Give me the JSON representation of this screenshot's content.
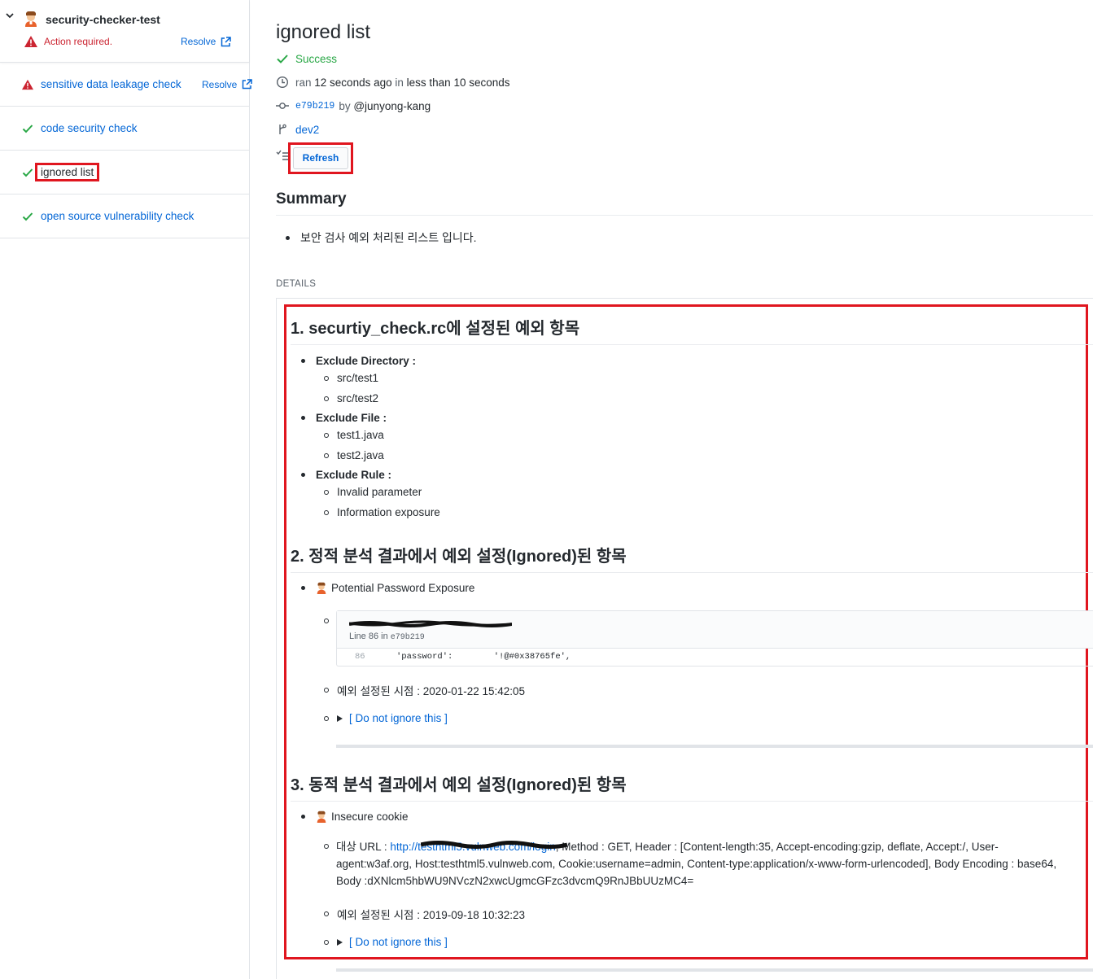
{
  "sidebar": {
    "app_name": "security-checker-test",
    "action_required": "Action required.",
    "resolve_label": "Resolve",
    "items": [
      {
        "label": "sensitive data leakage check",
        "status": "warning",
        "resolve": "Resolve"
      },
      {
        "label": "code security check",
        "status": "success"
      },
      {
        "label": "ignored list",
        "status": "success",
        "active": true
      },
      {
        "label": "open source vulnerability check",
        "status": "success"
      }
    ]
  },
  "run": {
    "title": "ignored list",
    "status": "Success",
    "ran_prefix": "ran",
    "ran_when": "12 seconds ago",
    "in_word": "in",
    "duration": "less than 10 seconds",
    "commit_sha": "e79b219",
    "by_word": "by",
    "author": "@junyong-kang",
    "branch": "dev2",
    "refresh_label": "Refresh"
  },
  "summary": {
    "heading": "Summary",
    "item": "보안 검사 예외 처리된 리스트 입니다."
  },
  "details": {
    "label": "DETAILS",
    "section1": {
      "heading": "1. securtiy_check.rc에 설정된 예외 항목",
      "groups": [
        {
          "title": "Exclude Directory :",
          "items": [
            "src/test1",
            "src/test2"
          ]
        },
        {
          "title": "Exclude File :",
          "items": [
            "test1.java",
            "test2.java"
          ]
        },
        {
          "title": "Exclude Rule :",
          "items": [
            "Invalid parameter",
            "Information exposure"
          ]
        }
      ]
    },
    "section2": {
      "heading": "2. 정적 분석 결과에서 예외 설정(Ignored)된 항목",
      "item_title": "Potential Password Exposure",
      "code_line_info": "Line 86 in",
      "code_sha": "e79b219",
      "line_number": "86",
      "code_text": "'password':        '!@#0x38765fe',",
      "ignored_at": "예외 설정된 시점 : 2020-01-22 15:42:05",
      "do_not_ignore": "[ Do not ignore this ]"
    },
    "section3": {
      "heading": "3. 동적 분석 결과에서 예외 설정(Ignored)된 항목",
      "item_title": "Insecure cookie",
      "target_prefix": "대상 URL : ",
      "target_url": "http://testhtml5.vulnweb.com/login",
      "target_rest": ", Method : GET, Header : [Content-length:35, Accept-encoding:gzip, deflate, Accept:/, User-agent:w3af.org, Host:testhtml5.vulnweb.com, Cookie:username=admin, Content-type:application/x-www-form-urlencoded], Body Encoding : base64, Body :dXNlcm5hbWU9NVczN2xwcUgmcGFzc3dvcmQ9RnJBbUUzMC4=",
      "ignored_at": "예외 설정된 시점 : 2019-09-18 10:32:23",
      "do_not_ignore": "[ Do not ignore this ]"
    }
  },
  "colors": {
    "link": "#0366d6",
    "success": "#28a745",
    "danger": "#cb2431",
    "highlight_frame": "#e0161f"
  },
  "icons": [
    "chevron-down-icon",
    "avatar-icon",
    "alert-icon",
    "external-link-icon",
    "check-icon",
    "clock-icon",
    "commit-icon",
    "branch-icon",
    "tasklist-icon",
    "triangle-right-icon"
  ]
}
